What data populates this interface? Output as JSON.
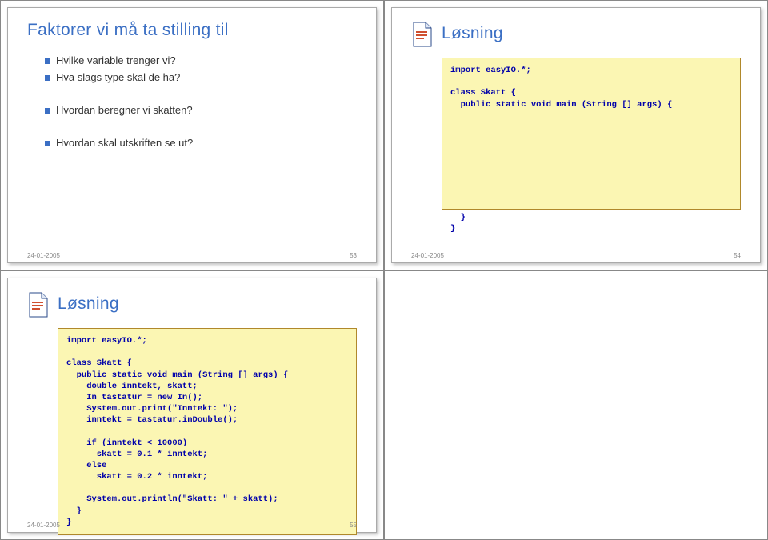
{
  "slides": {
    "tl": {
      "title": "Faktorer vi må ta stilling til",
      "bullets": [
        "Hvilke variable trenger vi?",
        "Hva slags type skal de ha?",
        "Hvordan beregner vi skatten?",
        "Hvordan skal utskriften se ut?"
      ],
      "footer_date": "24-01-2005",
      "footer_page": "53"
    },
    "tr": {
      "title": "Løsning",
      "code": "import easyIO.*;\n\nclass Skatt {\n  public static void main (String [] args) {\n\n\n\n\n\n\n\n\n\n  }\n}",
      "footer_date": "24-01-2005",
      "footer_page": "54"
    },
    "bl": {
      "title": "Løsning",
      "code": "import easyIO.*;\n\nclass Skatt {\n  public static void main (String [] args) {\n    double inntekt, skatt;\n    In tastatur = new In();\n    System.out.print(\"Inntekt: \");\n    inntekt = tastatur.inDouble();\n\n    if (inntekt < 10000)\n      skatt = 0.1 * inntekt;\n    else\n      skatt = 0.2 * inntekt;\n\n    System.out.println(\"Skatt: \" + skatt);\n  }\n}",
      "footer_date": "24-01-2005",
      "footer_page": "55"
    }
  }
}
